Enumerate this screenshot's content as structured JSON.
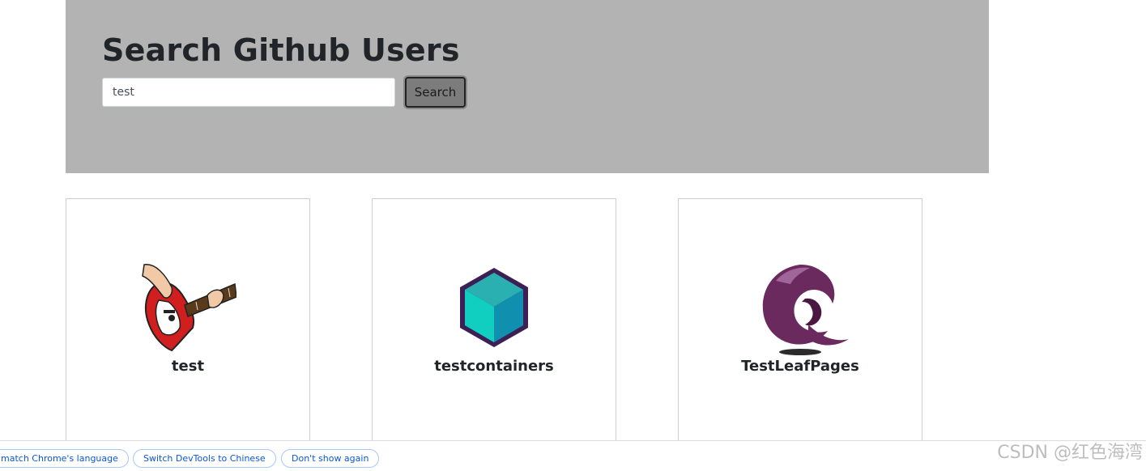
{
  "header": {
    "title": "Search Github Users",
    "search_value": "test",
    "search_button": "Search"
  },
  "users": [
    {
      "login": "test",
      "avatar_icon": "guitar-avatar-icon"
    },
    {
      "login": "testcontainers",
      "avatar_icon": "cube-avatar-icon"
    },
    {
      "login": "TestLeafPages",
      "avatar_icon": "bird-logo-avatar-icon"
    }
  ],
  "devtools": {
    "language_button": "match Chrome's language",
    "switch_button": "Switch DevTools to Chinese",
    "dismiss_button": "Don't show again"
  },
  "watermark": "CSDN @红色海湾",
  "colors": {
    "jumbotron": "#b3b3b3",
    "cube_top": "#2ab0b0",
    "cube_left": "#11cfc0",
    "cube_right": "#118fae",
    "cube_outline": "#3b1f55",
    "bird_logo": "#6b2a5e",
    "link_blue": "#0b57d0"
  }
}
